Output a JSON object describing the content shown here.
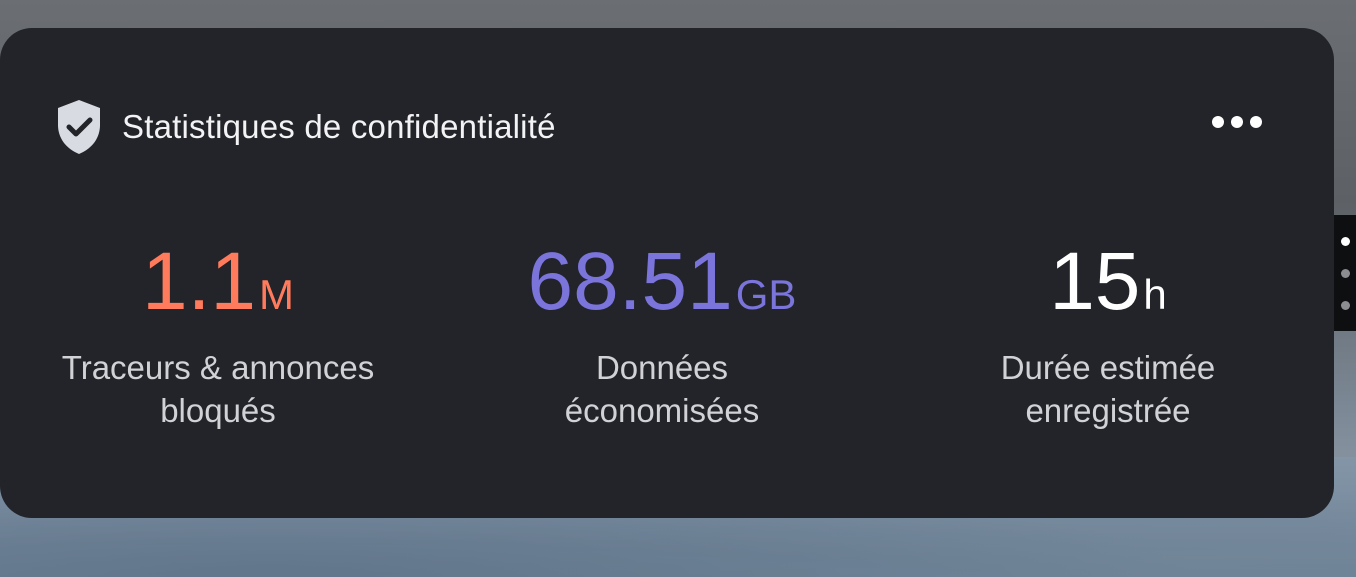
{
  "widget": {
    "title": "Statistiques de confidentialité",
    "icon": "shield-check-icon",
    "menu_icon": "more-horizontal-icon"
  },
  "stats": [
    {
      "value": "1.1",
      "unit": "M",
      "label_line1": "Traceurs & annonces",
      "label_line2": "bloqués",
      "color": "#ff7b5c"
    },
    {
      "value": "68.51",
      "unit": "GB",
      "label_line1": "Données",
      "label_line2": "économisées",
      "color": "#7a74db"
    },
    {
      "value": "15",
      "unit": "h",
      "label_line1": "Durée estimée",
      "label_line2": "enregistrée",
      "color": "#ffffff"
    }
  ],
  "pager": {
    "pages": 3,
    "active_index": 0
  },
  "colors": {
    "card_background": "#222429",
    "accent_orange": "#ff7b5c",
    "accent_blue": "#7a74db"
  }
}
